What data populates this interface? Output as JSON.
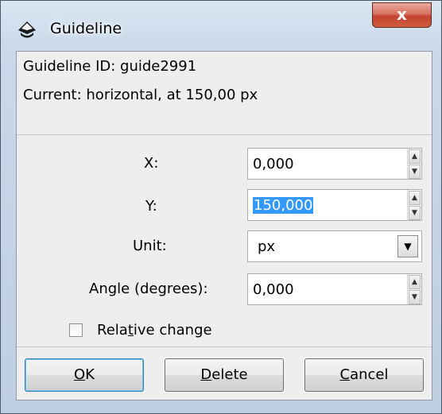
{
  "window": {
    "title": "Guideline",
    "close_label": "x"
  },
  "info": {
    "guide_id": "Guideline ID: guide2991",
    "current": "Current: horizontal, at 150,00 px"
  },
  "fields": {
    "x": {
      "label": "X:",
      "value": "0,000"
    },
    "y": {
      "label": "Y:",
      "value": "150,000"
    },
    "unit": {
      "label": "Unit:",
      "value": "px"
    },
    "angle": {
      "label": "Angle (degrees):",
      "value": "0,000"
    }
  },
  "relative": {
    "label_pre": "Rela",
    "label_u": "t",
    "label_post": "ive change",
    "checked": false
  },
  "buttons": {
    "ok": {
      "u": "O",
      "rest": "K"
    },
    "delete": {
      "u": "D",
      "rest": "elete"
    },
    "cancel": {
      "u": "C",
      "rest": "ancel"
    }
  }
}
